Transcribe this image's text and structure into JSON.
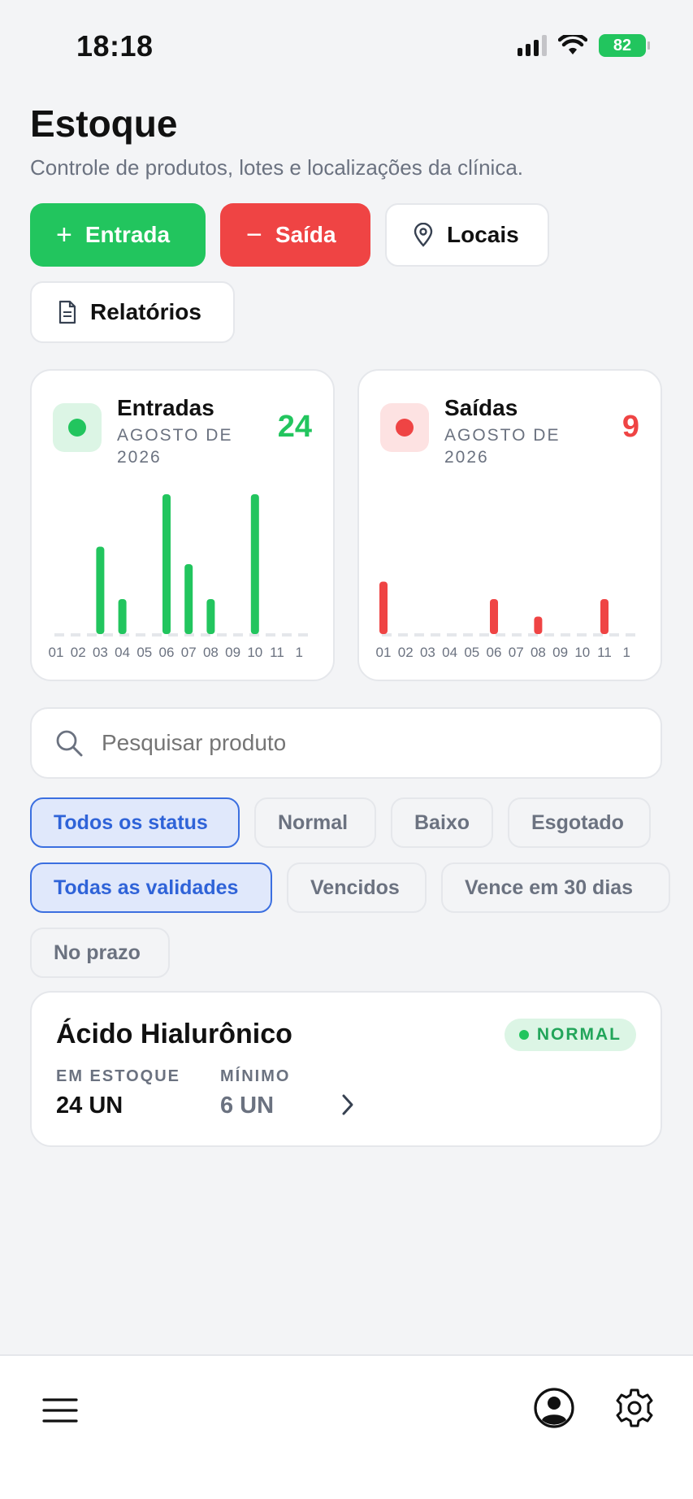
{
  "status_bar": {
    "time": "18:18",
    "battery": "82"
  },
  "header": {
    "title": "Estoque",
    "subtitle": "Controle de produtos, lotes e localizações da clínica."
  },
  "actions": {
    "entrada": "Entrada",
    "saida": "Saída",
    "locais": "Locais",
    "relatorios": "Relatórios"
  },
  "colors": {
    "green": "#22c55e",
    "red": "#ef4444",
    "blue": "#2f63d8"
  },
  "cards": [
    {
      "title": "Entradas",
      "period": "AGOSTO DE 2026",
      "count": "24",
      "color": "#22c55e",
      "soft": "#dcf5e5"
    },
    {
      "title": "Saídas",
      "period": "AGOSTO DE 2026",
      "count": "9",
      "color": "#ef4444",
      "soft": "#fde2e2"
    }
  ],
  "chart_data": [
    {
      "type": "bar",
      "categories": [
        "01",
        "02",
        "03",
        "04",
        "05",
        "06",
        "07",
        "08",
        "09",
        "10",
        "11",
        "1"
      ],
      "values": [
        0,
        0,
        5,
        2,
        0,
        8,
        4,
        2,
        0,
        8,
        0,
        0
      ],
      "color": "#22c55e",
      "grid": false
    },
    {
      "type": "bar",
      "categories": [
        "01",
        "02",
        "03",
        "04",
        "05",
        "06",
        "07",
        "08",
        "09",
        "10",
        "11",
        "1"
      ],
      "values": [
        3,
        0,
        0,
        0,
        0,
        2,
        0,
        1,
        0,
        0,
        2,
        0
      ],
      "color": "#ef4444",
      "grid": false
    }
  ],
  "search": {
    "placeholder": "Pesquisar produto"
  },
  "filters": {
    "status": [
      "Todos os status",
      "Normal",
      "Baixo",
      "Esgotado"
    ],
    "validity": [
      "Todas as validades",
      "Vencidos",
      "Vence em 30 dias",
      "No prazo"
    ],
    "active_status": "Todos os status",
    "active_validity": "Todas as validades"
  },
  "product": {
    "name": "Ácido Hialurônico",
    "status": "NORMAL",
    "stock_label": "EM ESTOQUE",
    "stock_value": "24 UN",
    "min_label": "MÍNIMO",
    "min_value": "6 UN"
  },
  "bottom_nav": {
    "icons": [
      "menu-icon",
      "user-icon",
      "gear-icon"
    ]
  }
}
